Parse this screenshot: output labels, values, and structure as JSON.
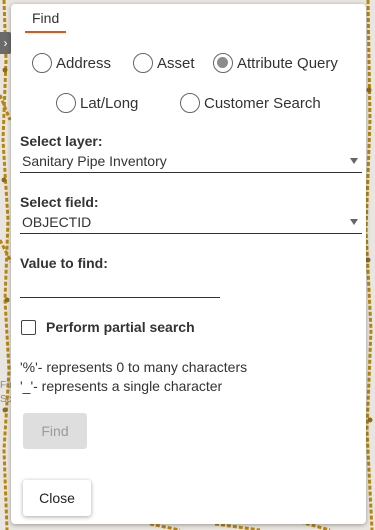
{
  "panel": {
    "tab_label": "Find",
    "search_types": [
      {
        "label": "Address",
        "checked": false
      },
      {
        "label": "Asset",
        "checked": false
      },
      {
        "label": "Attribute Query",
        "checked": true
      },
      {
        "label": "Lat/Long",
        "checked": false
      },
      {
        "label": "Customer Search",
        "checked": false
      }
    ],
    "layer": {
      "label": "Select layer:",
      "value": "Sanitary Pipe Inventory"
    },
    "field": {
      "label": "Select field:",
      "value": "OBJECTID"
    },
    "value_to_find": {
      "label": "Value to find:",
      "value": ""
    },
    "partial_search": {
      "label": "Perform partial search",
      "checked": false
    },
    "help": [
      "'%'- represents 0 to many characters",
      "'_'- represents a single character"
    ],
    "find_button": {
      "label": "Find",
      "enabled": false
    },
    "close_button": {
      "label": "Close"
    }
  },
  "map": {
    "partial_labels": [
      "Fo",
      "Sc"
    ],
    "expand_handle_icon": "chevron-right-icon",
    "pipe_color": "#b8860b"
  },
  "colors": {
    "tab_underline": "#e0541c",
    "radio_checked": "#8c8c8c",
    "find_disabled_bg": "#dedede"
  }
}
